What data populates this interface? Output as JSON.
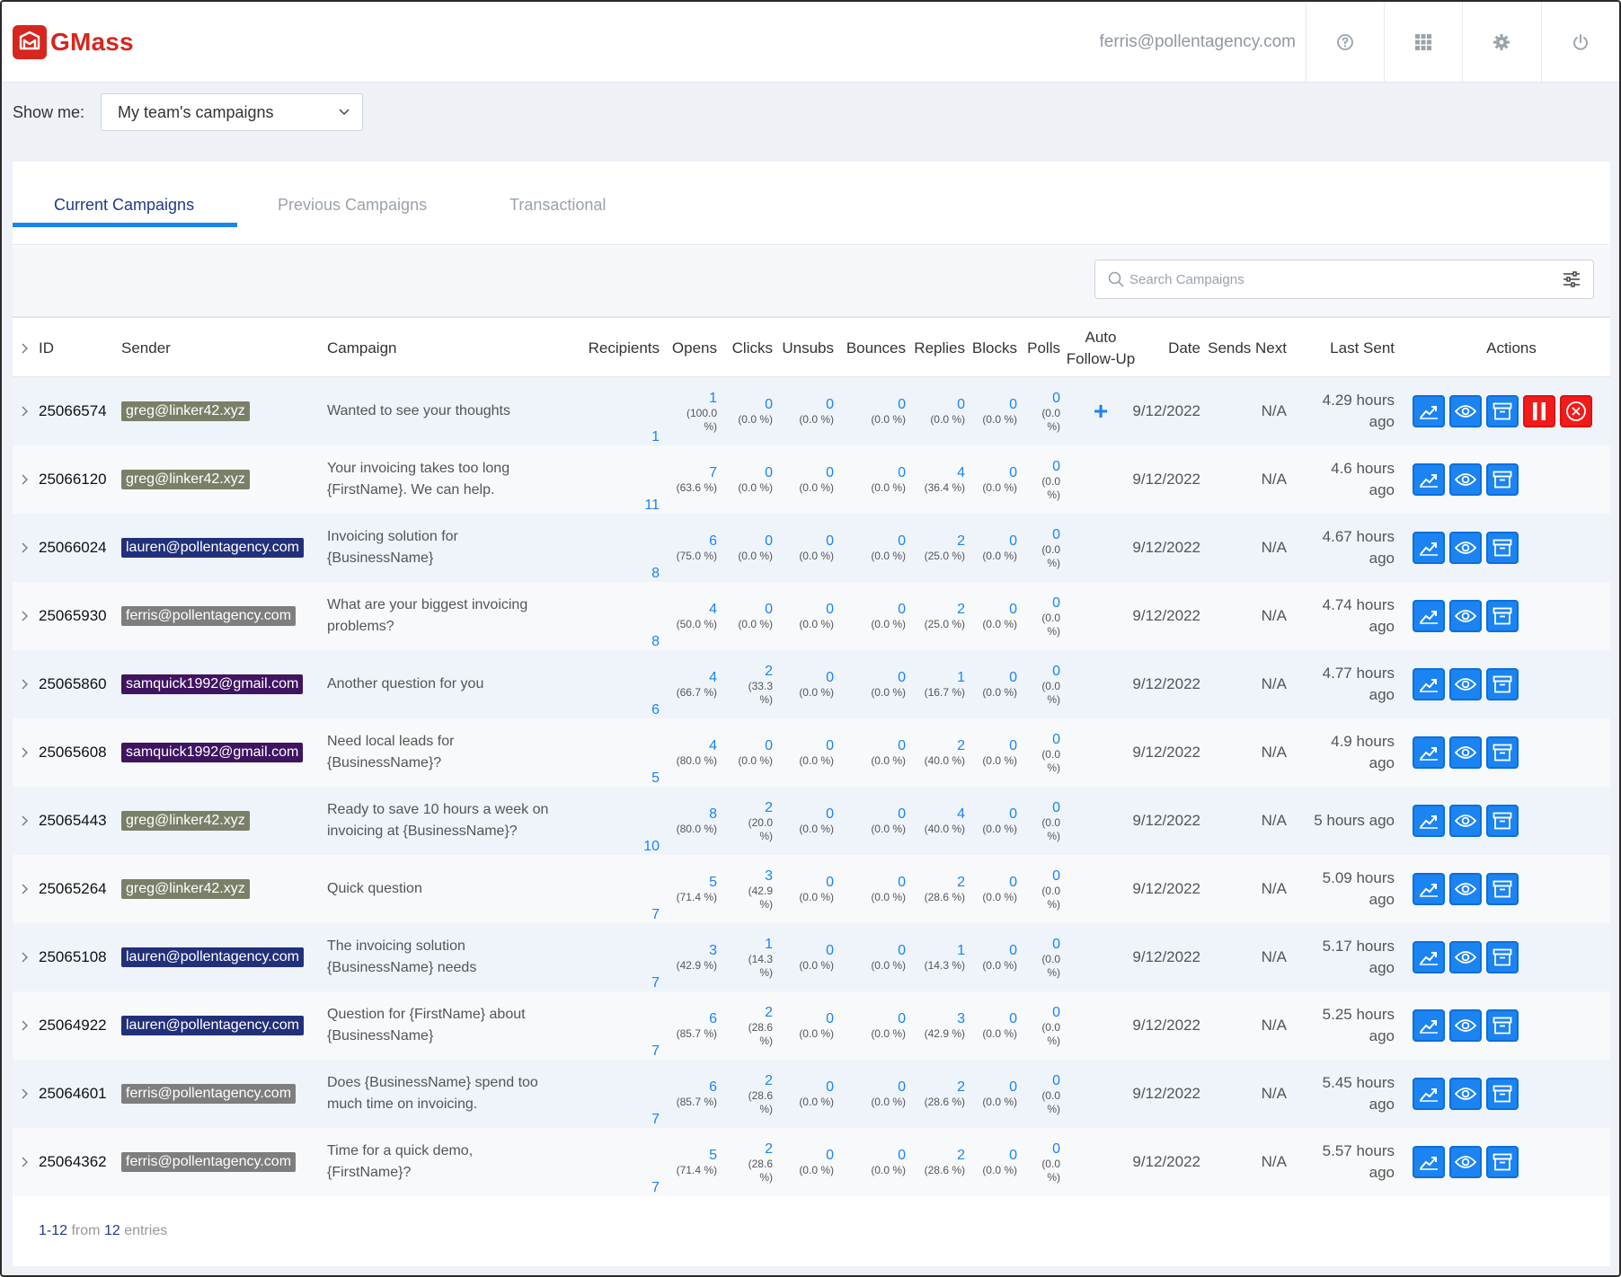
{
  "app": {
    "name": "GMass",
    "user_email": "ferris@pollentagency.com"
  },
  "filter": {
    "label": "Show me:",
    "selected": "My team's campaigns"
  },
  "tabs": [
    {
      "label": "Current Campaigns",
      "active": true
    },
    {
      "label": "Previous Campaigns",
      "active": false
    },
    {
      "label": "Transactional",
      "active": false
    }
  ],
  "search": {
    "placeholder": "Search Campaigns"
  },
  "columns": {
    "id": "ID",
    "sender": "Sender",
    "campaign": "Campaign",
    "recipients": "Recipients",
    "opens": "Opens",
    "clicks": "Clicks",
    "unsubs": "Unsubs",
    "bounces": "Bounces",
    "replies": "Replies",
    "blocks": "Blocks",
    "polls": "Polls",
    "auto_followup_1": "Auto",
    "auto_followup_2": "Follow-Up",
    "date": "Date",
    "sends_next": "Sends Next",
    "last_sent": "Last Sent",
    "actions": "Actions"
  },
  "sender_colors": {
    "greg@linker42.xyz": "#7a8068",
    "lauren@pollentagency.com": "#22307a",
    "ferris@pollentagency.com": "#7e7e7e",
    "samquick1992@gmail.com": "#3f1460"
  },
  "colors": {
    "accent": "#1b84f2",
    "danger": "#f01b1b",
    "brand": "#d7261e"
  },
  "rows": [
    {
      "id": "25066574",
      "sender": "greg@linker42.xyz",
      "campaign": "Wanted to see your thoughts",
      "recipients": "1",
      "opens": [
        "1",
        "(100.0",
        "%)"
      ],
      "clicks": [
        "0",
        "(0.0 %)"
      ],
      "unsubs": [
        "0",
        "(0.0 %)"
      ],
      "bounces": [
        "0",
        "(0.0 %)"
      ],
      "replies": [
        "0",
        "(0.0 %)"
      ],
      "blocks": [
        "0",
        "(0.0 %)"
      ],
      "polls": [
        "0",
        "(0.0",
        "%)"
      ],
      "auto": "+",
      "date": "9/12/2022",
      "sends_next": "N/A",
      "last_sent": "4.29 hours ago",
      "extra_actions": true
    },
    {
      "id": "25066120",
      "sender": "greg@linker42.xyz",
      "campaign": "Your invoicing takes too long {FirstName}. We can help.",
      "recipients": "11",
      "opens": [
        "7",
        "(63.6 %)"
      ],
      "clicks": [
        "0",
        "(0.0 %)"
      ],
      "unsubs": [
        "0",
        "(0.0 %)"
      ],
      "bounces": [
        "0",
        "(0.0 %)"
      ],
      "replies": [
        "4",
        "(36.4 %)"
      ],
      "blocks": [
        "0",
        "(0.0 %)"
      ],
      "polls": [
        "0",
        "(0.0",
        "%)"
      ],
      "auto": "",
      "date": "9/12/2022",
      "sends_next": "N/A",
      "last_sent": "4.6 hours ago",
      "extra_actions": false
    },
    {
      "id": "25066024",
      "sender": "lauren@pollentagency.com",
      "campaign": "Invoicing solution for {BusinessName}",
      "recipients": "8",
      "opens": [
        "6",
        "(75.0 %)"
      ],
      "clicks": [
        "0",
        "(0.0 %)"
      ],
      "unsubs": [
        "0",
        "(0.0 %)"
      ],
      "bounces": [
        "0",
        "(0.0 %)"
      ],
      "replies": [
        "2",
        "(25.0 %)"
      ],
      "blocks": [
        "0",
        "(0.0 %)"
      ],
      "polls": [
        "0",
        "(0.0",
        "%)"
      ],
      "auto": "",
      "date": "9/12/2022",
      "sends_next": "N/A",
      "last_sent": "4.67 hours ago",
      "extra_actions": false
    },
    {
      "id": "25065930",
      "sender": "ferris@pollentagency.com",
      "campaign": "What are your biggest invoicing problems?",
      "recipients": "8",
      "opens": [
        "4",
        "(50.0 %)"
      ],
      "clicks": [
        "0",
        "(0.0 %)"
      ],
      "unsubs": [
        "0",
        "(0.0 %)"
      ],
      "bounces": [
        "0",
        "(0.0 %)"
      ],
      "replies": [
        "2",
        "(25.0 %)"
      ],
      "blocks": [
        "0",
        "(0.0 %)"
      ],
      "polls": [
        "0",
        "(0.0",
        "%)"
      ],
      "auto": "",
      "date": "9/12/2022",
      "sends_next": "N/A",
      "last_sent": "4.74 hours ago",
      "extra_actions": false
    },
    {
      "id": "25065860",
      "sender": "samquick1992@gmail.com",
      "campaign": "Another question for you",
      "recipients": "6",
      "opens": [
        "4",
        "(66.7 %)"
      ],
      "clicks": [
        "2",
        "(33.3",
        "%)"
      ],
      "unsubs": [
        "0",
        "(0.0 %)"
      ],
      "bounces": [
        "0",
        "(0.0 %)"
      ],
      "replies": [
        "1",
        "(16.7 %)"
      ],
      "blocks": [
        "0",
        "(0.0 %)"
      ],
      "polls": [
        "0",
        "(0.0",
        "%)"
      ],
      "auto": "",
      "date": "9/12/2022",
      "sends_next": "N/A",
      "last_sent": "4.77 hours ago",
      "extra_actions": false
    },
    {
      "id": "25065608",
      "sender": "samquick1992@gmail.com",
      "campaign": "Need local leads for {BusinessName}?",
      "recipients": "5",
      "opens": [
        "4",
        "(80.0 %)"
      ],
      "clicks": [
        "0",
        "(0.0 %)"
      ],
      "unsubs": [
        "0",
        "(0.0 %)"
      ],
      "bounces": [
        "0",
        "(0.0 %)"
      ],
      "replies": [
        "2",
        "(40.0 %)"
      ],
      "blocks": [
        "0",
        "(0.0 %)"
      ],
      "polls": [
        "0",
        "(0.0",
        "%)"
      ],
      "auto": "",
      "date": "9/12/2022",
      "sends_next": "N/A",
      "last_sent": "4.9 hours ago",
      "extra_actions": false
    },
    {
      "id": "25065443",
      "sender": "greg@linker42.xyz",
      "campaign": "Ready to save 10 hours a week on invoicing at {BusinessName}?",
      "recipients": "10",
      "opens": [
        "8",
        "(80.0 %)"
      ],
      "clicks": [
        "2",
        "(20.0",
        "%)"
      ],
      "unsubs": [
        "0",
        "(0.0 %)"
      ],
      "bounces": [
        "0",
        "(0.0 %)"
      ],
      "replies": [
        "4",
        "(40.0 %)"
      ],
      "blocks": [
        "0",
        "(0.0 %)"
      ],
      "polls": [
        "0",
        "(0.0",
        "%)"
      ],
      "auto": "",
      "date": "9/12/2022",
      "sends_next": "N/A",
      "last_sent": "5 hours ago",
      "extra_actions": false
    },
    {
      "id": "25065264",
      "sender": "greg@linker42.xyz",
      "campaign": "Quick question",
      "recipients": "7",
      "opens": [
        "5",
        "(71.4 %)"
      ],
      "clicks": [
        "3",
        "(42.9",
        "%)"
      ],
      "unsubs": [
        "0",
        "(0.0 %)"
      ],
      "bounces": [
        "0",
        "(0.0 %)"
      ],
      "replies": [
        "2",
        "(28.6 %)"
      ],
      "blocks": [
        "0",
        "(0.0 %)"
      ],
      "polls": [
        "0",
        "(0.0",
        "%)"
      ],
      "auto": "",
      "date": "9/12/2022",
      "sends_next": "N/A",
      "last_sent": "5.09 hours ago",
      "extra_actions": false
    },
    {
      "id": "25065108",
      "sender": "lauren@pollentagency.com",
      "campaign": "The invoicing solution {BusinessName} needs",
      "recipients": "7",
      "opens": [
        "3",
        "(42.9 %)"
      ],
      "clicks": [
        "1",
        "(14.3",
        "%)"
      ],
      "unsubs": [
        "0",
        "(0.0 %)"
      ],
      "bounces": [
        "0",
        "(0.0 %)"
      ],
      "replies": [
        "1",
        "(14.3 %)"
      ],
      "blocks": [
        "0",
        "(0.0 %)"
      ],
      "polls": [
        "0",
        "(0.0",
        "%)"
      ],
      "auto": "",
      "date": "9/12/2022",
      "sends_next": "N/A",
      "last_sent": "5.17 hours ago",
      "extra_actions": false
    },
    {
      "id": "25064922",
      "sender": "lauren@pollentagency.com",
      "campaign": "Question for {FirstName} about {BusinessName}",
      "recipients": "7",
      "opens": [
        "6",
        "(85.7 %)"
      ],
      "clicks": [
        "2",
        "(28.6",
        "%)"
      ],
      "unsubs": [
        "0",
        "(0.0 %)"
      ],
      "bounces": [
        "0",
        "(0.0 %)"
      ],
      "replies": [
        "3",
        "(42.9 %)"
      ],
      "blocks": [
        "0",
        "(0.0 %)"
      ],
      "polls": [
        "0",
        "(0.0",
        "%)"
      ],
      "auto": "",
      "date": "9/12/2022",
      "sends_next": "N/A",
      "last_sent": "5.25 hours ago",
      "extra_actions": false
    },
    {
      "id": "25064601",
      "sender": "ferris@pollentagency.com",
      "campaign": "Does {BusinessName} spend too much time on invoicing.",
      "recipients": "7",
      "opens": [
        "6",
        "(85.7 %)"
      ],
      "clicks": [
        "2",
        "(28.6",
        "%)"
      ],
      "unsubs": [
        "0",
        "(0.0 %)"
      ],
      "bounces": [
        "0",
        "(0.0 %)"
      ],
      "replies": [
        "2",
        "(28.6 %)"
      ],
      "blocks": [
        "0",
        "(0.0 %)"
      ],
      "polls": [
        "0",
        "(0.0",
        "%)"
      ],
      "auto": "",
      "date": "9/12/2022",
      "sends_next": "N/A",
      "last_sent": "5.45 hours ago",
      "extra_actions": false
    },
    {
      "id": "25064362",
      "sender": "ferris@pollentagency.com",
      "campaign": "Time for a quick demo, {FirstName}?",
      "recipients": "7",
      "opens": [
        "5",
        "(71.4 %)"
      ],
      "clicks": [
        "2",
        "(28.6",
        "%)"
      ],
      "unsubs": [
        "0",
        "(0.0 %)"
      ],
      "bounces": [
        "0",
        "(0.0 %)"
      ],
      "replies": [
        "2",
        "(28.6 %)"
      ],
      "blocks": [
        "0",
        "(0.0 %)"
      ],
      "polls": [
        "0",
        "(0.0",
        "%)"
      ],
      "auto": "",
      "date": "9/12/2022",
      "sends_next": "N/A",
      "last_sent": "5.57 hours ago",
      "extra_actions": false
    }
  ],
  "footer": {
    "range": "1-12",
    "from_word": "from",
    "total": "12",
    "entries_word": "entries"
  },
  "icons": {
    "top": [
      "help-circle-icon",
      "apps-grid-icon",
      "settings-gear-icon",
      "power-icon"
    ],
    "actions": [
      "report-chart-icon",
      "view-eye-icon",
      "archive-box-icon",
      "pause-icon",
      "cancel-circle-icon"
    ],
    "search": "search-icon",
    "filter": "filter-sliders-icon",
    "expand": "chevron-right-icon"
  }
}
